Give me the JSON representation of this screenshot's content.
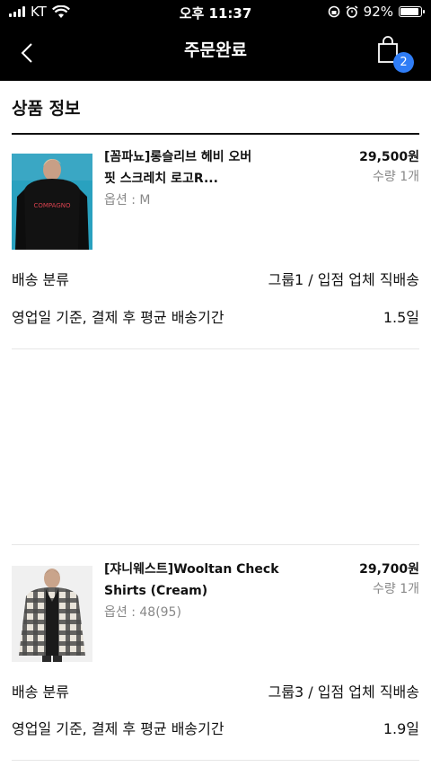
{
  "status_bar": {
    "carrier": "KT",
    "time": "오후 11:37",
    "battery": "92%",
    "battery_level": 0.92
  },
  "nav": {
    "title": "주문완료",
    "cart_count": "2"
  },
  "section_title": "상품 정보",
  "products": [
    {
      "name_line1": "[꼼파뇨]롱슬리브 헤비 오버",
      "name_line2": "핏 스크레치 로고R...",
      "option": "옵션 : M",
      "price": "29,500원",
      "quantity": "수량 1개",
      "shipping_label": "배송 분류",
      "shipping_value": "그룹1 / 입점 업체 직배송",
      "delivery_label": "영업일 기준, 결제 후 평균 배송기간",
      "delivery_value": "1.5일",
      "thumb_print": "COMPAGNO"
    },
    {
      "name_line1": "[쟈니웨스트]Wooltan Check",
      "name_line2": "Shirts (Cream)",
      "option": "옵션 : 48(95)",
      "price": "29,700원",
      "quantity": "수량 1개",
      "shipping_label": "배송 분류",
      "shipping_value": "그룹3 / 입점 업체 직배송",
      "delivery_label": "영업일 기준, 결제 후 평균 배송기간",
      "delivery_value": "1.9일"
    }
  ],
  "colors": {
    "header_bg": "#000000",
    "badge": "#2f7df6",
    "muted_text": "#888888",
    "product1_bg": "#3aa7c4"
  }
}
